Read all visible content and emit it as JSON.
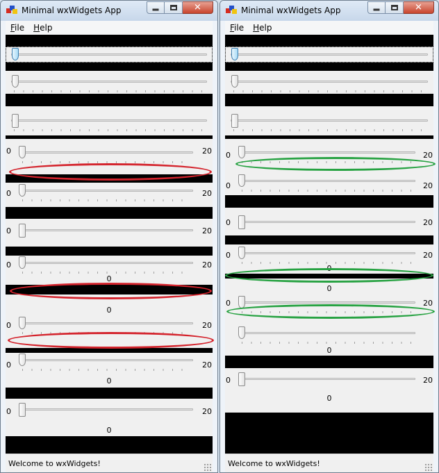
{
  "left_window": {
    "title": "Minimal wxWidgets App",
    "menu": [
      {
        "label": "File",
        "mnemonic": "F",
        "rest": "ile"
      },
      {
        "label": "Help",
        "mnemonic": "H",
        "rest": "elp"
      }
    ],
    "status_text": "Welcome to wxWidgets!",
    "sliders": [
      {
        "value": 0
      },
      {
        "value": 0
      },
      {
        "value": 0
      },
      {
        "value": 0,
        "min_label": "0",
        "max_label": "20"
      },
      {
        "value": 0,
        "min_label": "0",
        "max_label": "20"
      },
      {
        "value": 0,
        "min_label": "0",
        "max_label": "20"
      },
      {
        "value": 0,
        "min_label": "0",
        "max_label": "20",
        "value_label": "0"
      },
      {
        "value": 0,
        "value_label": "0"
      },
      {
        "value": 0,
        "min_label": "0",
        "max_label": "20"
      },
      {
        "value": 0,
        "min_label": "0",
        "max_label": "20",
        "value_label": "0"
      },
      {
        "value": 0,
        "min_label": "0",
        "max_label": "20",
        "value_label": "0"
      }
    ]
  },
  "right_window": {
    "title": "Minimal wxWidgets App",
    "menu": [
      {
        "label": "File",
        "mnemonic": "F",
        "rest": "ile"
      },
      {
        "label": "Help",
        "mnemonic": "H",
        "rest": "elp"
      }
    ],
    "status_text": "Welcome to wxWidgets!",
    "sliders": [
      {
        "value": 0
      },
      {
        "value": 0
      },
      {
        "value": 0
      },
      {
        "value": 0,
        "min_label": "0",
        "max_label": "20"
      },
      {
        "value": 0,
        "min_label": "0",
        "max_label": "20"
      },
      {
        "value": 0,
        "min_label": "0",
        "max_label": "20"
      },
      {
        "value": 0,
        "min_label": "0",
        "max_label": "20",
        "value_label": "0"
      },
      {
        "value": 0,
        "value_label": "0"
      },
      {
        "value": 0,
        "min_label": "0",
        "max_label": "20"
      },
      {
        "value": 0,
        "value_label": "0"
      },
      {
        "value": 0,
        "min_label": "0",
        "max_label": "20",
        "value_label": "0"
      }
    ]
  },
  "window_buttons": {
    "minimize": "minimize-icon",
    "maximize": "maximize-icon",
    "close": "close-icon",
    "close_glyph": "✕"
  },
  "annotation_colors": {
    "red": "#d4242d",
    "green": "#27a242"
  }
}
